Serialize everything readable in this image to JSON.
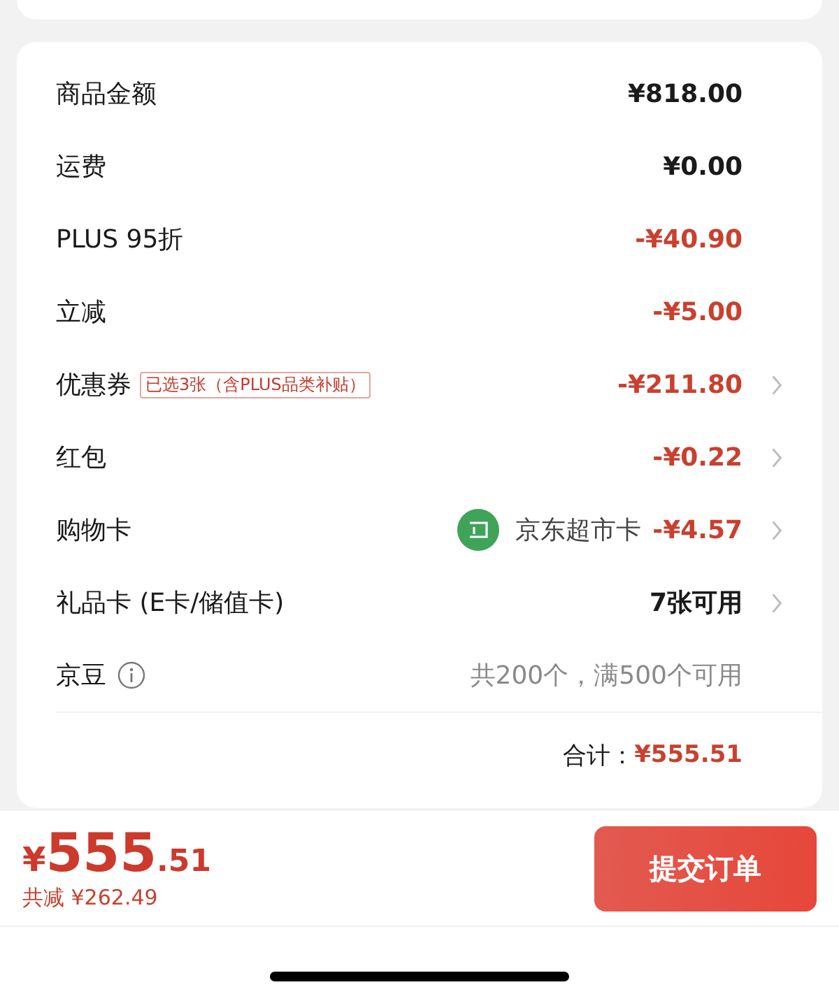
{
  "rows": [
    {
      "label": "商品金额",
      "value": "¥818.00",
      "kind": "normal",
      "chevron": false
    },
    {
      "label": "运费",
      "value": "¥0.00",
      "kind": "normal",
      "chevron": false
    },
    {
      "label": "PLUS 95折",
      "value": "-¥40.90",
      "kind": "discount",
      "chevron": false
    },
    {
      "label": "立减",
      "value": "-¥5.00",
      "kind": "discount",
      "chevron": false
    },
    {
      "label": "优惠券",
      "tag": "已选3张（含PLUS品类补贴）",
      "value": "-¥211.80",
      "kind": "discount",
      "chevron": true
    },
    {
      "label": "红包",
      "value": "-¥0.22",
      "kind": "discount",
      "chevron": true
    },
    {
      "label": "购物卡",
      "card_name": "京东超市卡",
      "value": "-¥4.57",
      "kind": "discount",
      "chevron": true
    },
    {
      "label": "礼品卡 (E卡/储值卡)",
      "value": "7张可用",
      "kind": "normal",
      "chevron": true
    },
    {
      "label": "京豆",
      "info": true,
      "value": "共200个，满500个可用",
      "kind": "muted",
      "chevron": false
    }
  ],
  "total": {
    "label": "合计：",
    "value": "¥555.51"
  },
  "footer": {
    "currency": "¥",
    "price_integer": "555",
    "price_decimal": ".51",
    "saving": "共减 ¥262.49",
    "submit": "提交订单"
  }
}
